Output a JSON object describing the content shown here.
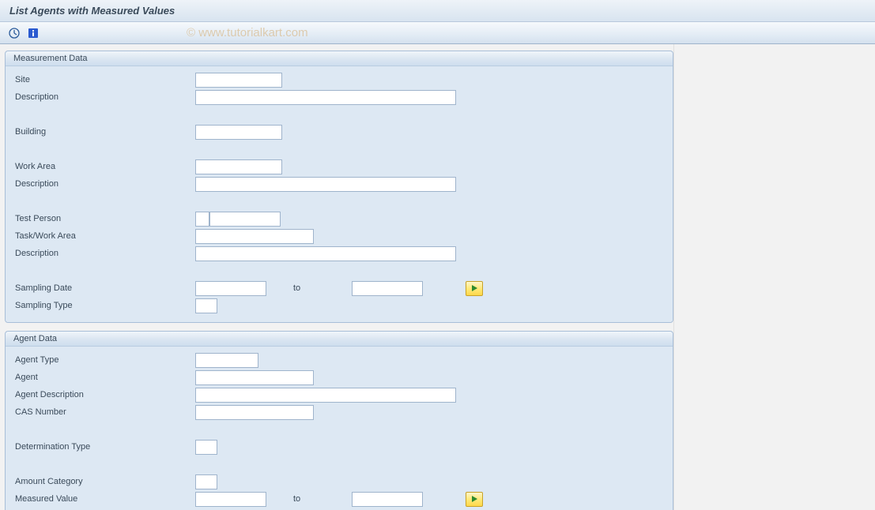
{
  "title": "List Agents with Measured Values",
  "watermark": "© www.tutorialkart.com",
  "groups": {
    "measurement": {
      "title": "Measurement Data",
      "labels": {
        "site": "Site",
        "site_desc": "Description",
        "building": "Building",
        "work_area": "Work Area",
        "work_area_desc": "Description",
        "test_person": "Test Person",
        "task_work_area": "Task/Work Area",
        "task_desc": "Description",
        "sampling_date": "Sampling Date",
        "sampling_date_to": "to",
        "sampling_type": "Sampling Type"
      },
      "values": {
        "site": "",
        "site_desc": "",
        "building": "",
        "work_area": "",
        "work_area_desc": "",
        "test_person_a": "",
        "test_person_b": "",
        "task_work_area": "",
        "task_desc": "",
        "sampling_date_from": "",
        "sampling_date_to": "",
        "sampling_type": ""
      }
    },
    "agent": {
      "title": "Agent Data",
      "labels": {
        "agent_type": "Agent Type",
        "agent": "Agent",
        "agent_desc": "Agent Description",
        "cas_number": "CAS Number",
        "determination_type": "Determination Type",
        "amount_category": "Amount Category",
        "measured_value": "Measured Value",
        "measured_value_to": "to"
      },
      "values": {
        "agent_type": "",
        "agent": "",
        "agent_desc": "",
        "cas_number": "",
        "determination_type": "",
        "amount_category": "",
        "measured_value_from": "",
        "measured_value_to": ""
      }
    }
  }
}
